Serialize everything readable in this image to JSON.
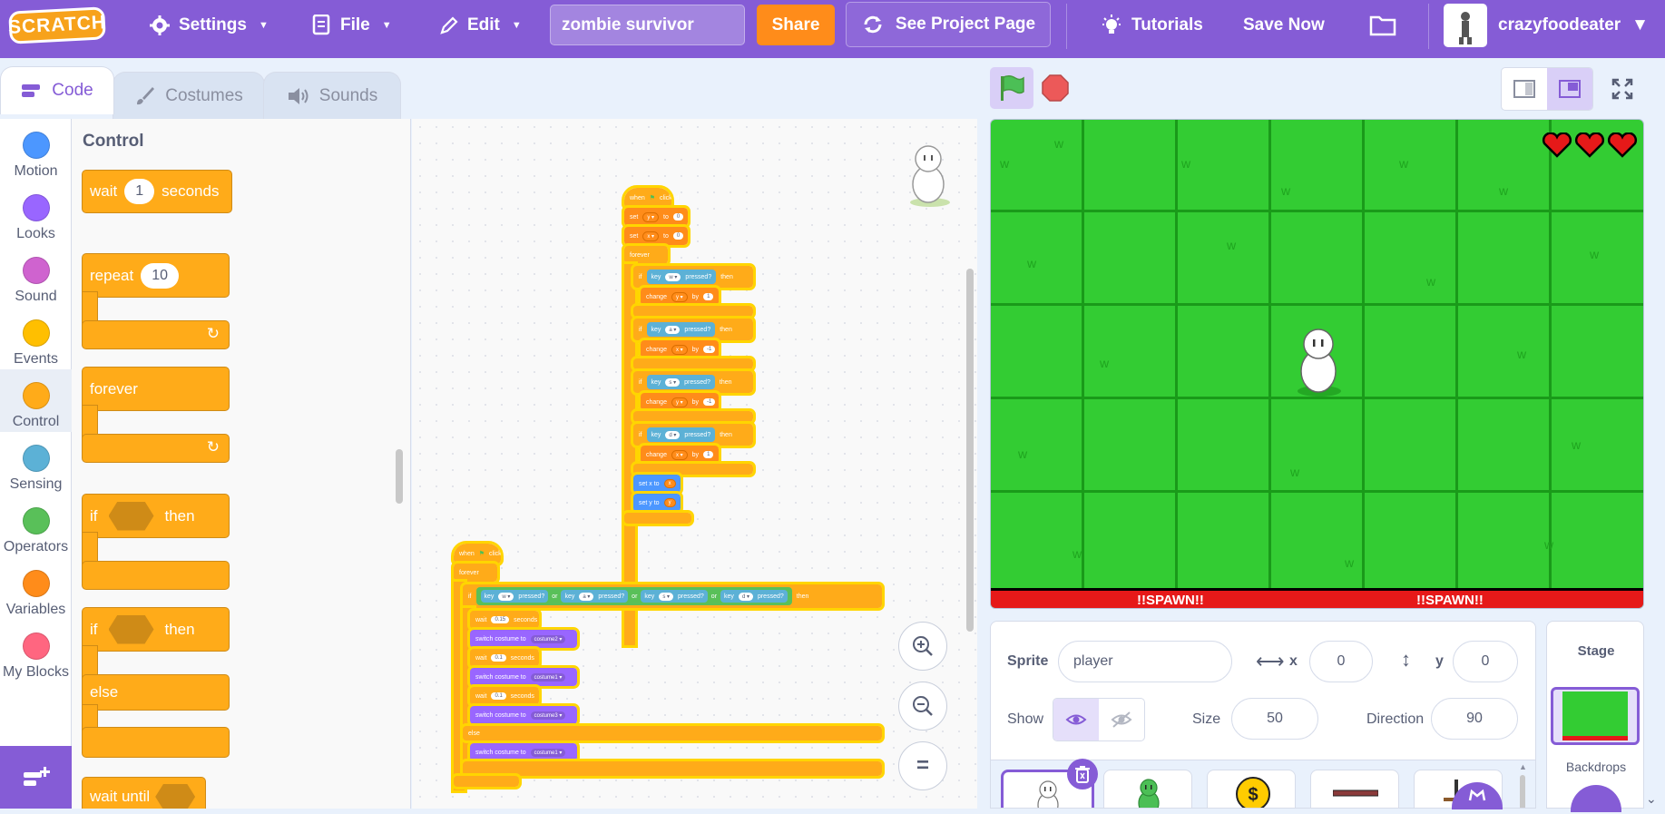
{
  "menu": {
    "logo": "SCRATCH",
    "settings": "Settings",
    "file": "File",
    "edit": "Edit",
    "project_title": "zombie survivor",
    "share": "Share",
    "see_project_page": "See Project Page",
    "tutorials": "Tutorials",
    "save_now": "Save Now",
    "username": "crazyfoodeater"
  },
  "tabs": {
    "code": "Code",
    "costumes": "Costumes",
    "sounds": "Sounds"
  },
  "categories": [
    {
      "label": "Motion",
      "color": "#4c97ff"
    },
    {
      "label": "Looks",
      "color": "#9966ff"
    },
    {
      "label": "Sound",
      "color": "#cf63cf"
    },
    {
      "label": "Events",
      "color": "#ffbf00"
    },
    {
      "label": "Control",
      "color": "#ffab19"
    },
    {
      "label": "Sensing",
      "color": "#5cb1d6"
    },
    {
      "label": "Operators",
      "color": "#59c059"
    },
    {
      "label": "Variables",
      "color": "#ff8c1a"
    },
    {
      "label": "My Blocks",
      "color": "#ff6680"
    }
  ],
  "palette": {
    "title": "Control",
    "wait": "wait",
    "wait_value": "1",
    "seconds": "seconds",
    "repeat": "repeat",
    "repeat_value": "10",
    "forever": "forever",
    "if": "if",
    "then": "then",
    "if2": "if",
    "then2": "then",
    "else": "else",
    "wait_until": "wait until"
  },
  "scripts": {
    "s1": {
      "hat": "when",
      "hat_clicked": "clicked",
      "set_y": "set",
      "y_var": "y ▾",
      "to": "to",
      "zero": "0",
      "set_x": "set",
      "x_var": "x ▾",
      "forever": "forever",
      "if": "if",
      "key": "key",
      "pressed": "pressed?",
      "then": "then",
      "w": "w ▾",
      "s": "s ▾",
      "a": "a ▾",
      "d": "d ▾",
      "change": "change",
      "by": "by",
      "one": "1",
      "neg_one": "-1",
      "set_x_to": "set x to",
      "set_y_to": "set y to",
      "x_rep": "x",
      "y_rep": "y"
    },
    "s2": {
      "forever": "forever",
      "or": "or",
      "wait": "wait",
      "w1": "0.15",
      "w2": "0.1",
      "seconds": "seconds",
      "switch_costume": "switch costume to",
      "c2": "costume2 ▾",
      "c1": "costume1 ▾",
      "c3": "costume3 ▾",
      "else": "else"
    }
  },
  "stage": {
    "spawn_left": "!!SPAWN!!",
    "spawn_right": "!!SPAWN!!"
  },
  "sprite_info": {
    "sprite_label": "Sprite",
    "sprite_name": "player",
    "x_label": "x",
    "x_value": "0",
    "y_label": "y",
    "y_value": "0",
    "show_label": "Show",
    "size_label": "Size",
    "size_value": "50",
    "direction_label": "Direction",
    "direction_value": "90"
  },
  "stage_panel": {
    "title": "Stage",
    "backdrops": "Backdrops"
  },
  "colors": {
    "brand": "#855cd6",
    "control": "#ffab19",
    "share": "#ff8c1a",
    "stage_green": "#33cc33",
    "spawn_red": "#e61919"
  }
}
